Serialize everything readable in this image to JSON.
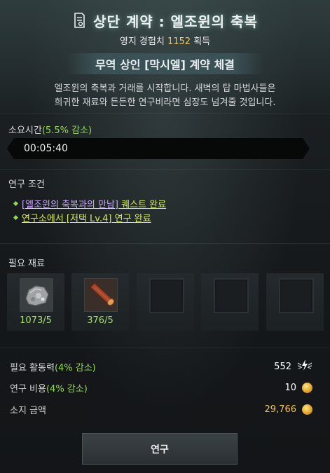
{
  "header": {
    "title": "상단 계약 : 엘조윈의 축복",
    "exp_prefix": "영지 경험치",
    "exp_value": "1152",
    "exp_suffix": "획득",
    "contract": "무역 상인 [막시엘] 계약 체결",
    "description_line1": "엘조윈의 축복과 거래를 시작합니다. 새벽의 탑 마법사들은",
    "description_line2": "희귀한 재료와 든든한 연구비라면 심장도 넘겨줄 것입니다."
  },
  "time": {
    "label": "소요시간",
    "reduction": "(5.5% 감소)",
    "value": "00:05:40"
  },
  "conditions": {
    "label": "연구 조건",
    "items": [
      {
        "name": "[엘조윈의 축복과의 만남]",
        "suffix": " 퀘스트 완료"
      },
      {
        "name": "연구소에서 [저택 Lv.4] 연구 완료",
        "suffix": ""
      }
    ]
  },
  "materials": {
    "label": "필요 재료",
    "items": [
      {
        "icon": "ore-icon",
        "count": "1073/5"
      },
      {
        "icon": "timber-icon",
        "count": "376/5"
      }
    ]
  },
  "stats": {
    "activity_label": "필요 활동력",
    "activity_reduction": "(4% 감소)",
    "activity_value": "552",
    "cost_label": "연구 비용",
    "cost_reduction": "(4% 감소)",
    "cost_value": "10",
    "owned_label": "소지 금액",
    "owned_value": "29,766"
  },
  "button": {
    "research": "연구"
  },
  "colors": {
    "accent_green": "#8fdc4a",
    "gold": "#f2c64a",
    "link_yellow": "#d6ec56",
    "link_purple": "#c9a6ff"
  }
}
